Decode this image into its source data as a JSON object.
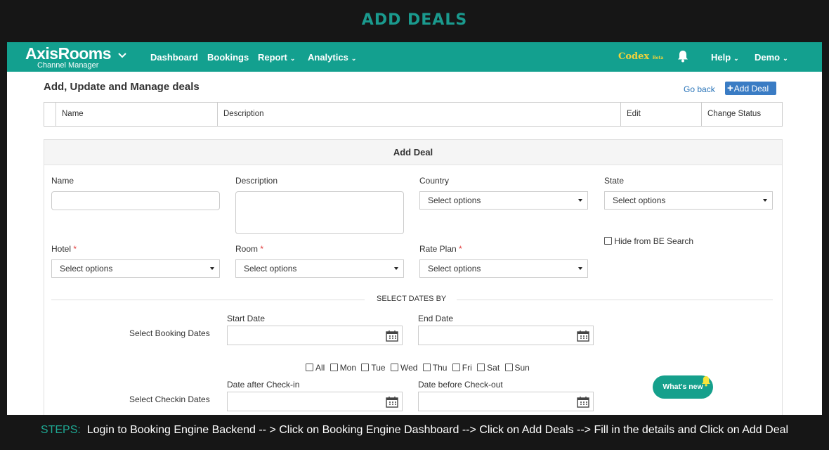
{
  "banner": {
    "title": "ADD DEALS"
  },
  "navbar": {
    "logo": "AxisRooms",
    "logo_sub": "Channel Manager",
    "items": [
      {
        "label": "Dashboard"
      },
      {
        "label": "Bookings"
      },
      {
        "label": "Report"
      },
      {
        "label": "Analytics"
      }
    ],
    "codex": "Codex",
    "codex_badge": "Beta",
    "help": "Help",
    "user": "Demo"
  },
  "page": {
    "heading": "Add, Update and Manage deals",
    "go_back": "Go back",
    "add_deal_btn": "Add Deal",
    "table_headers": {
      "name": "Name",
      "description": "Description",
      "edit": "Edit",
      "status": "Change Status"
    }
  },
  "form": {
    "title": "Add Deal",
    "name_label": "Name",
    "name_value": "",
    "description_label": "Description",
    "description_value": "",
    "country_label": "Country",
    "country_value": "Select options",
    "state_label": "State",
    "state_value": "Select options",
    "hotel_label": "Hotel",
    "hotel_value": "Select options",
    "room_label": "Room",
    "room_value": "Select options",
    "rate_plan_label": "Rate Plan",
    "rate_plan_value": "Select options",
    "required_mark": "*",
    "hide_be_label": "Hide from BE Search",
    "select_dates_by": "SELECT DATES BY",
    "booking_dates_label": "Select Booking Dates",
    "start_date_label": "Start Date",
    "end_date_label": "End Date",
    "days": [
      "All",
      "Mon",
      "Tue",
      "Wed",
      "Thu",
      "Fri",
      "Sat",
      "Sun"
    ],
    "checkin_dates_label": "Select Checkin Dates",
    "date_after_checkin_label": "Date after Check-in",
    "date_before_checkout_label": "Date before Check-out"
  },
  "widgets": {
    "whats_new": "What's new"
  },
  "steps": {
    "label": "STEPS:",
    "text": "Login to Booking Engine Backend -- > Click on Booking Engine Dashboard --> Click on Add Deals --> Fill in the details and Click on Add Deal"
  },
  "colors": {
    "brand_teal": "#13a08f",
    "link_blue": "#2873b8",
    "button_blue": "#3a7cc4",
    "required_red": "#e03a3a",
    "codex_yellow": "#f2d33a"
  },
  "icons": [
    "chevron-down-icon",
    "bell-icon",
    "plus-icon",
    "calendar-icon",
    "caret-down-icon",
    "chat-icon"
  ]
}
